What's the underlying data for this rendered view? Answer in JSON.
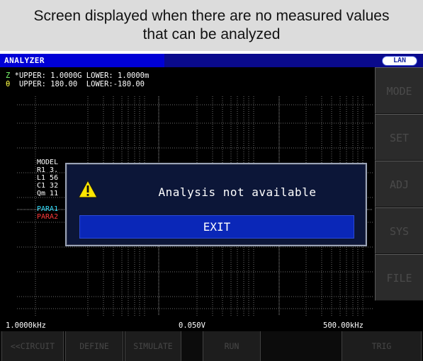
{
  "caption": {
    "line1": "Screen displayed when there are no measured values",
    "line2": "that can be analyzed"
  },
  "titlebar": {
    "title": "ANALYZER",
    "lan_badge": "LAN"
  },
  "limits": {
    "z_symbol": "Z",
    "z_text": "*UPPER: 1.0000G LOWER: 1.0000m",
    "theta_symbol": "θ",
    "theta_text": " UPPER: 180.00  LOWER:-180.00"
  },
  "model": {
    "lines": [
      "MODEL",
      "R1 3.",
      "L1 56",
      "C1 32",
      "Qm 11"
    ],
    "para1": "PARA1",
    "para2": "PARA2"
  },
  "side_menu": [
    "MODE",
    "SET",
    "ADJ",
    "SYS",
    "FILE"
  ],
  "footer": {
    "start_freq": "1.0000kHz",
    "level": "0.050V",
    "stop_freq": "500.00kHz"
  },
  "bottom_menu": {
    "circuit": "<<CIRCUIT",
    "define": "DEFINE",
    "simulate": "SIMULATE",
    "run": "RUN",
    "trig": "TRIG"
  },
  "dialog": {
    "message": "Analysis not available",
    "exit_label": "EXIT",
    "icon": "warning-triangle-icon"
  },
  "colors": {
    "title_blue": "#0000d6",
    "dialog_button": "#0a27b8",
    "warning": "#ffe600",
    "para1": "#37e1ff",
    "para2": "#ff3b3b"
  }
}
